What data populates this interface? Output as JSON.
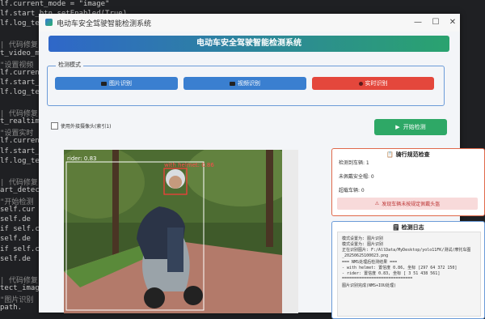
{
  "editor": {
    "lines": [
      {
        "text": "lf.current_mode = \"image\"",
        "comment": false
      },
      {
        "text": "lf.start_btn.setEnabled(True)",
        "comment": false
      },
      {
        "text": "lf.log_te",
        "comment": false
      },
      {
        "text": "",
        "comment": false
      },
      {
        "text": "| 代码修复",
        "comment": true
      },
      {
        "text": "t_video_m",
        "comment": false
      },
      {
        "text": "\"设置视频",
        "comment": true
      },
      {
        "text": "lf.curren",
        "comment": false
      },
      {
        "text": "lf.start_",
        "comment": false
      },
      {
        "text": "lf.log_te",
        "comment": false
      },
      {
        "text": "",
        "comment": false
      },
      {
        "text": "| 代码修复",
        "comment": true
      },
      {
        "text": "t_realtim",
        "comment": false
      },
      {
        "text": "\"设置实时",
        "comment": true
      },
      {
        "text": "lf.curren",
        "comment": false
      },
      {
        "text": "lf.start_",
        "comment": false
      },
      {
        "text": "lf.log_te",
        "comment": false
      },
      {
        "text": "",
        "comment": false
      },
      {
        "text": "| 代码修复",
        "comment": true
      },
      {
        "text": "art_detec",
        "comment": false
      },
      {
        "text": "\"开始检测",
        "comment": true
      },
      {
        "text": "self.cur",
        "comment": false
      },
      {
        "text": "self.de",
        "comment": false
      },
      {
        "text": "if self.cu",
        "comment": false
      },
      {
        "text": "self.de",
        "comment": false
      },
      {
        "text": "if self.cu",
        "comment": false
      },
      {
        "text": "self.de",
        "comment": false
      },
      {
        "text": "",
        "comment": false
      },
      {
        "text": "| 代码修复",
        "comment": true
      },
      {
        "text": "tect_image",
        "comment": false
      },
      {
        "text": "\"图片识别",
        "comment": true
      },
      {
        "text": "path.",
        "comment": false
      }
    ]
  },
  "window": {
    "title": "电动车安全驾驶智能检测系统",
    "minimize": "—",
    "maximize": "☐",
    "close": "✕"
  },
  "banner": "电动车安全驾驶智能检测系统",
  "mode": {
    "legend": "检测模式",
    "buttons": [
      {
        "label": "图片识别",
        "color": "#3a7fd0"
      },
      {
        "label": "视频识别",
        "color": "#3a7fd0"
      },
      {
        "label": "实时识别",
        "color": "#e4473c"
      }
    ]
  },
  "camera_check": "使用外接摄像头(索引1)",
  "start_button": "开始检测",
  "video": {
    "detections": [
      {
        "label": "with helmet: 0.86"
      },
      {
        "label": "rider: 0.83"
      }
    ]
  },
  "violation": {
    "title": "骑行规范检查",
    "rider_count": "检测到车辆: 1",
    "no_helmet": "未佩戴安全帽: 0",
    "overload": "超载车辆: 0",
    "alert": "发现车辆未按规定佩戴头盔"
  },
  "log": {
    "title": "检测日志",
    "lines": [
      "模式设置为: 图片识别",
      "模式设置为: 图片识别",
      "正在识别图片: F:/AllData/MyDesktop/yolo11FK/测试/摩托车图",
      "_20250625100023.png",
      "=== NMS处理后检测结果 ===",
      "- with helmet: 置信度 0.86, 坐标 [297  64 372 150]",
      "- rider: 置信度 0.83, 坐标 [  3  51 438 561]",
      "=============================",
      "图片识别完成(NMS+IOU处理)"
    ]
  }
}
